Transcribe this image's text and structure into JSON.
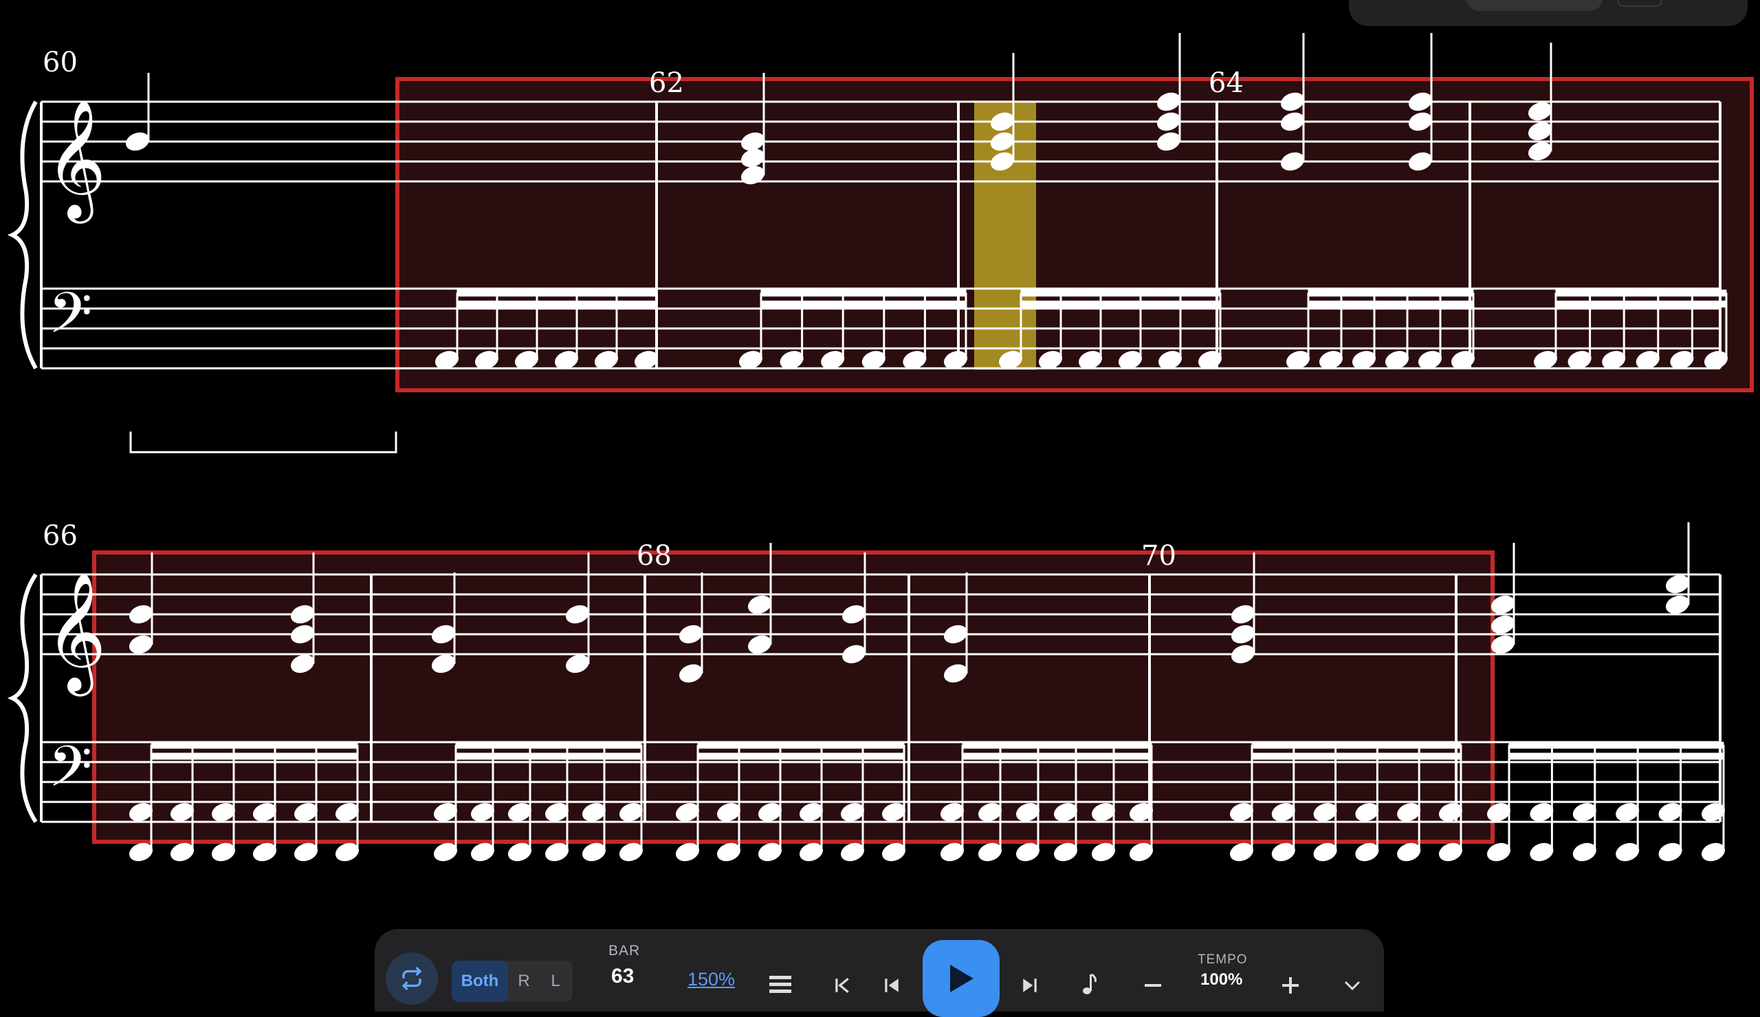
{
  "score": {
    "measure_numbers": [
      "60",
      "62",
      "64",
      "66",
      "68",
      "70"
    ]
  },
  "toolbar": {
    "loop_icon": "repeat-icon",
    "hands": {
      "both": "Both",
      "right": "R",
      "left": "L"
    },
    "bar_label": "BAR",
    "bar_value": "63",
    "zoom": "150%",
    "icons": {
      "layout": "hamburger-icon",
      "first": "skip-to-start-icon",
      "prev": "previous-bar-icon",
      "play": "play-icon",
      "next": "next-bar-icon",
      "metronome": "metronome-note-icon",
      "minus": "minus-icon",
      "plus": "plus-icon",
      "more": "chevron-down-icon"
    },
    "tempo_label": "TEMPO",
    "tempo_value": "100%"
  },
  "colors": {
    "background": "#000000",
    "loop_region_fill": "#2a0d0f",
    "loop_region_border": "#c62828",
    "cursor_highlight": "#b8a024",
    "accent_blue": "#3a8ff0"
  }
}
